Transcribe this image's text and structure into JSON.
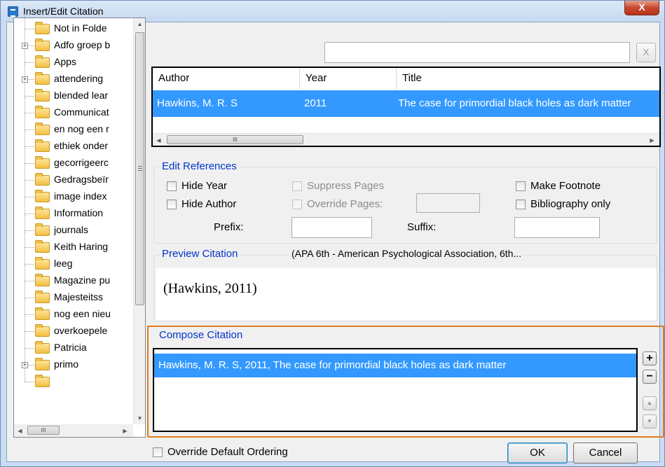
{
  "window": {
    "title": "Insert/Edit Citation",
    "close_label": "X"
  },
  "tree": {
    "items": [
      {
        "label": "Not in Folde",
        "expandable": false
      },
      {
        "label": "Adfo groep b",
        "expandable": true
      },
      {
        "label": "Apps",
        "expandable": false
      },
      {
        "label": "attendering",
        "expandable": true
      },
      {
        "label": "blended lear",
        "expandable": false
      },
      {
        "label": "Communicat",
        "expandable": false
      },
      {
        "label": "en nog een r",
        "expandable": false
      },
      {
        "label": "ethiek onder",
        "expandable": false
      },
      {
        "label": "gecorrigeerc",
        "expandable": false
      },
      {
        "label": "Gedragsbeïr",
        "expandable": false
      },
      {
        "label": "image index",
        "expandable": false
      },
      {
        "label": "Information",
        "expandable": false
      },
      {
        "label": "journals",
        "expandable": false
      },
      {
        "label": "Keith Haring",
        "expandable": false
      },
      {
        "label": "leeg",
        "expandable": false
      },
      {
        "label": "Magazine pu",
        "expandable": false
      },
      {
        "label": "Majesteitss",
        "expandable": false
      },
      {
        "label": "nog een nieu",
        "expandable": false
      },
      {
        "label": "overkoepele",
        "expandable": false
      },
      {
        "label": "Patricia",
        "expandable": false
      },
      {
        "label": "primo",
        "expandable": true
      },
      {
        "label": "",
        "expandable": false
      }
    ],
    "scroll_up_icon": "triangle-up",
    "scroll_down_icon": "triangle-down",
    "scroll_left_icon": "triangle-left",
    "scroll_right_icon": "triangle-right",
    "thumb_grip": "III"
  },
  "search": {
    "value": "",
    "clear_label": "X"
  },
  "references": {
    "columns": [
      "Author",
      "Year",
      "Title"
    ],
    "rows": [
      {
        "author": "Hawkins, M. R. S",
        "year": "2011",
        "title": "The case for primordial black holes as dark matter"
      }
    ],
    "thumb_grip": "III"
  },
  "edit_references": {
    "title": "Edit References",
    "hide_year": "Hide Year",
    "hide_author": "Hide Author",
    "suppress_pages": "Suppress Pages",
    "override_pages": "Override Pages:",
    "make_footnote": "Make Footnote",
    "bibliography_only": "Bibliography only",
    "prefix_label": "Prefix:",
    "suffix_label": "Suffix:",
    "prefix_value": "",
    "suffix_value": "",
    "override_pages_value": ""
  },
  "preview": {
    "title": "Preview Citation",
    "style": "(APA 6th - American Psychological Association, 6th...",
    "citation": "(Hawkins, 2011)"
  },
  "compose": {
    "title": "Compose Citation",
    "items": [
      "Hawkins, M. R. S, 2011, The case for primordial black holes as dark matter"
    ],
    "add_label": "+",
    "remove_label": "−",
    "up_icon": "triangle-up",
    "down_icon": "triangle-down"
  },
  "footer": {
    "override_ordering": "Override Default Ordering",
    "ok_label": "OK",
    "cancel_label": "Cancel"
  },
  "colors": {
    "selection": "#3399ff",
    "group_title": "#0033cc",
    "highlight_frame": "#e07b1e"
  }
}
